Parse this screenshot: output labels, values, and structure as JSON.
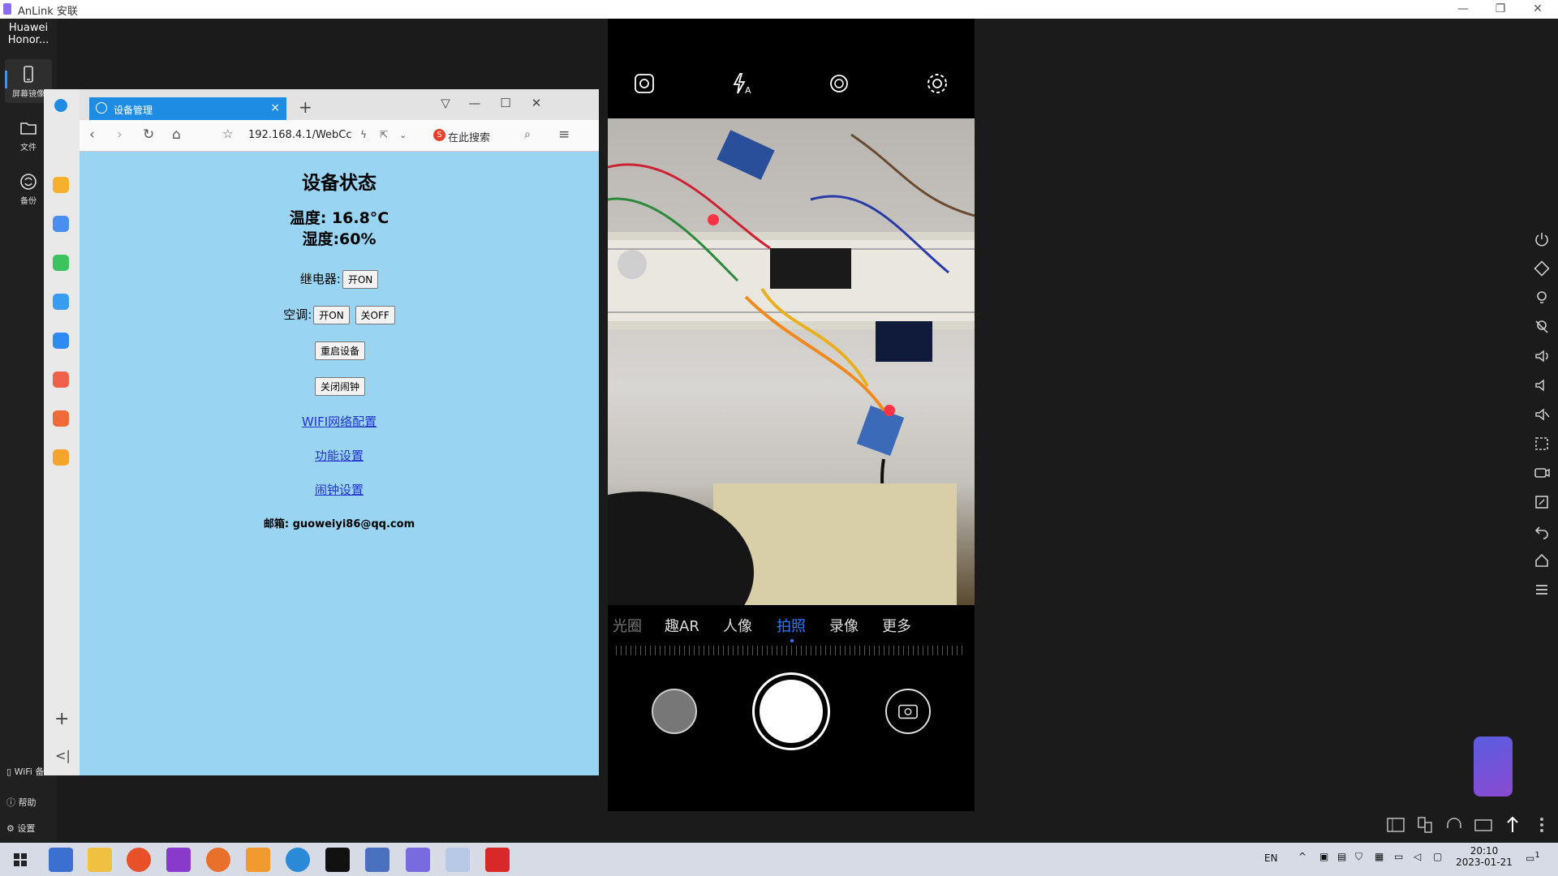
{
  "app": {
    "title": "AnLink 安联",
    "device_name_line1": "Huawei",
    "device_name_line2": "Honor..."
  },
  "left_nav": [
    {
      "label": "屏幕镜像",
      "icon": "phone-icon",
      "active": true
    },
    {
      "label": "文件",
      "icon": "folder-icon",
      "active": false
    },
    {
      "label": "备份",
      "icon": "sync-icon",
      "active": false
    }
  ],
  "left_bottom": {
    "wifi": "WiFi\n备",
    "help": "帮助",
    "settings": "设置"
  },
  "browser": {
    "tab_title": "设备管理",
    "address": "192.168.4.1/WebCc",
    "search_placeholder": "在此搜索"
  },
  "device_page": {
    "heading": "设备状态",
    "temperature": "温度: 16.8°C",
    "humidity": "湿度:60%",
    "relay_label": "继电器:",
    "relay_on": "开ON",
    "ac_label": "空调:",
    "ac_on": "开ON",
    "ac_off": "关OFF",
    "restart": "重启设备",
    "alarm_off": "关闭闹钟",
    "link_wifi": "WIFI网络配置",
    "link_func": "功能设置",
    "link_alarm": "闹钟设置",
    "email": "邮箱: guoweiyi86@qq.com"
  },
  "camera": {
    "modes": [
      "光圈",
      "趣AR",
      "人像",
      "拍照",
      "录像",
      "更多"
    ],
    "active_mode": "拍照",
    "flash_label": "A"
  },
  "taskbar": {
    "time": "20:10",
    "date": "2023-01-21",
    "ime": "EN",
    "notify_count": "1"
  },
  "colors": {
    "accent": "#1e8ce3",
    "page_bg": "#99d5f3",
    "active_mode": "#2f7bff"
  }
}
